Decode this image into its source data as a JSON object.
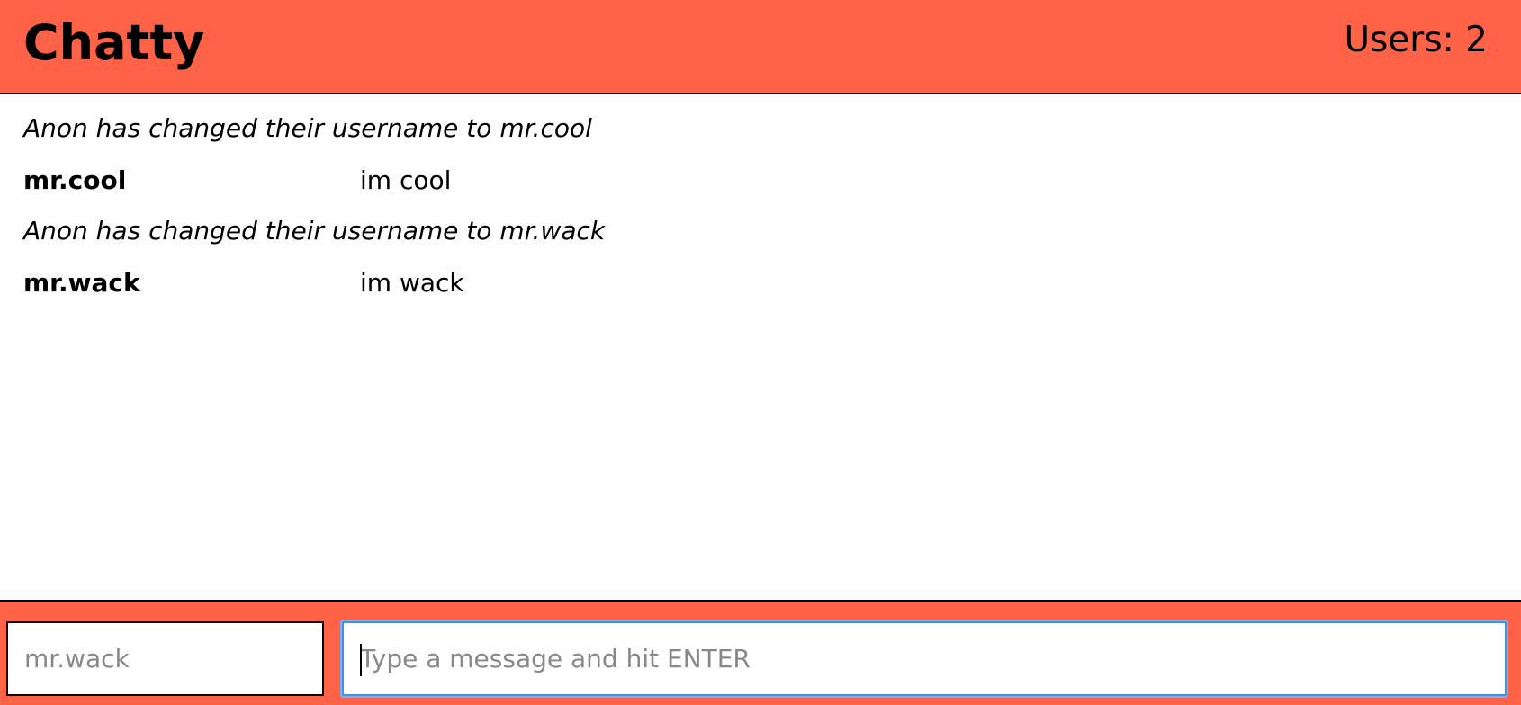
{
  "navbar": {
    "brand": "Chatty",
    "users_label": "Users: 2"
  },
  "messages": [
    {
      "type": "notification",
      "text": "Anon has changed their username to mr.cool"
    },
    {
      "type": "message",
      "username": "mr.cool",
      "content": "im cool"
    },
    {
      "type": "notification",
      "text": "Anon has changed their username to mr.wack"
    },
    {
      "type": "message",
      "username": "mr.wack",
      "content": "im wack"
    }
  ],
  "chatbar": {
    "username_placeholder": "mr.wack",
    "username_value": "",
    "message_placeholder": "Type a message and hit ENTER",
    "message_value": ""
  },
  "colors": {
    "accent": "#ff6347",
    "focus_ring": "#4a90e2"
  }
}
